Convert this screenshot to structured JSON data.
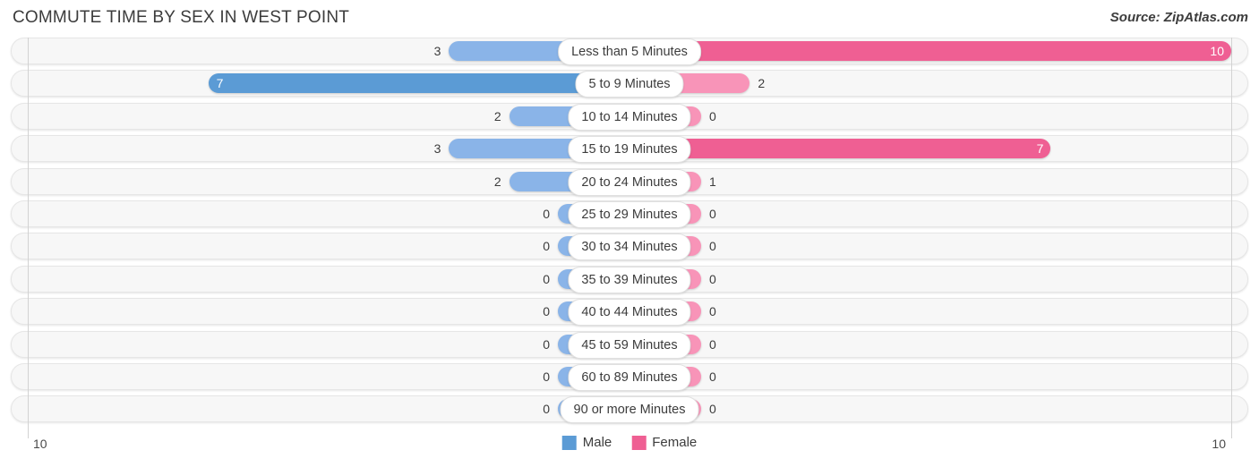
{
  "header": {
    "title": "COMMUTE TIME BY SEX IN WEST POINT",
    "source": "Source: ZipAtlas.com"
  },
  "colors": {
    "male_max": "#5b9bd5",
    "male_light": "#8ab4e8",
    "female_max": "#ef5f93",
    "female_light": "#f894b8",
    "track": "#f7f7f7",
    "gridline": "#d2d2d2"
  },
  "axis": {
    "left_label": "10",
    "right_label": "10",
    "max": 10
  },
  "legend": {
    "items": [
      {
        "label": "Male",
        "color": "#5b9bd5"
      },
      {
        "label": "Female",
        "color": "#ef5f93"
      }
    ]
  },
  "chart_data": {
    "type": "bar",
    "title": "COMMUTE TIME BY SEX IN WEST POINT",
    "subtitle": "",
    "xlabel": "",
    "ylabel": "",
    "orientation": "horizontal-diverging",
    "grid": true,
    "legend_position": "bottom-center",
    "axis_max": 10,
    "xlim": [
      10,
      0,
      10
    ],
    "categories": [
      "Less than 5 Minutes",
      "5 to 9 Minutes",
      "10 to 14 Minutes",
      "15 to 19 Minutes",
      "20 to 24 Minutes",
      "25 to 29 Minutes",
      "30 to 34 Minutes",
      "35 to 39 Minutes",
      "40 to 44 Minutes",
      "45 to 59 Minutes",
      "60 to 89 Minutes",
      "90 or more Minutes"
    ],
    "series": [
      {
        "name": "Male",
        "color": "#5b9bd5",
        "values": [
          3,
          7,
          2,
          3,
          2,
          0,
          0,
          0,
          0,
          0,
          0,
          0
        ]
      },
      {
        "name": "Female",
        "color": "#ef5f93",
        "values": [
          10,
          2,
          0,
          7,
          1,
          0,
          0,
          0,
          0,
          0,
          0,
          0
        ]
      }
    ]
  }
}
